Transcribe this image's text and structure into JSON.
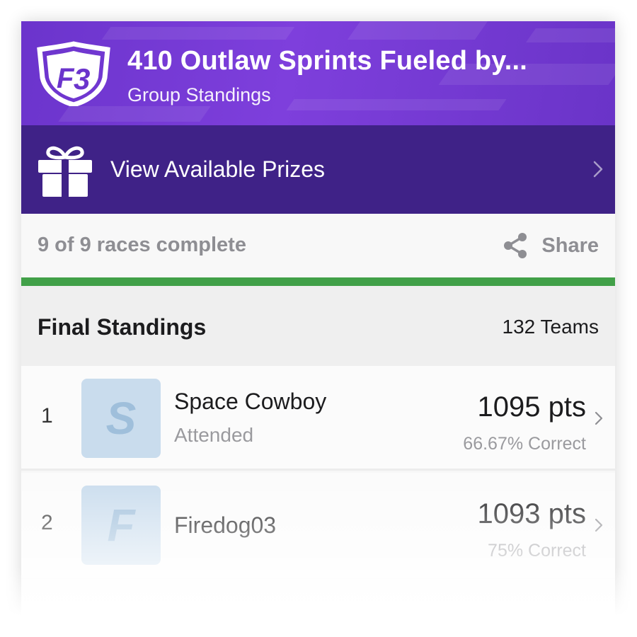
{
  "header": {
    "logo_name": "F3-shield-logo",
    "title": "410 Outlaw Sprints Fueled by...",
    "subtitle": "Group Standings",
    "accent_color": "#6b34cc"
  },
  "prizes": {
    "icon": "gift-icon",
    "label": "View Available Prizes",
    "background_color": "#3f2287"
  },
  "progress": {
    "text": "9 of 9 races complete",
    "completed": 9,
    "total": 9,
    "fraction": 1.0,
    "bar_color": "#41a048"
  },
  "share": {
    "icon": "share-icon",
    "label": "Share"
  },
  "standings": {
    "title": "Final Standings",
    "teams_count": "132 Teams",
    "rows": [
      {
        "rank": "1",
        "avatar_letter": "S",
        "name": "Space Cowboy",
        "sub": "Attended",
        "points": "1095 pts",
        "correct": "66.67% Correct"
      },
      {
        "rank": "2",
        "avatar_letter": "F",
        "name": "Firedog03",
        "sub": "",
        "points": "1093 pts",
        "correct": "75% Correct"
      }
    ]
  }
}
